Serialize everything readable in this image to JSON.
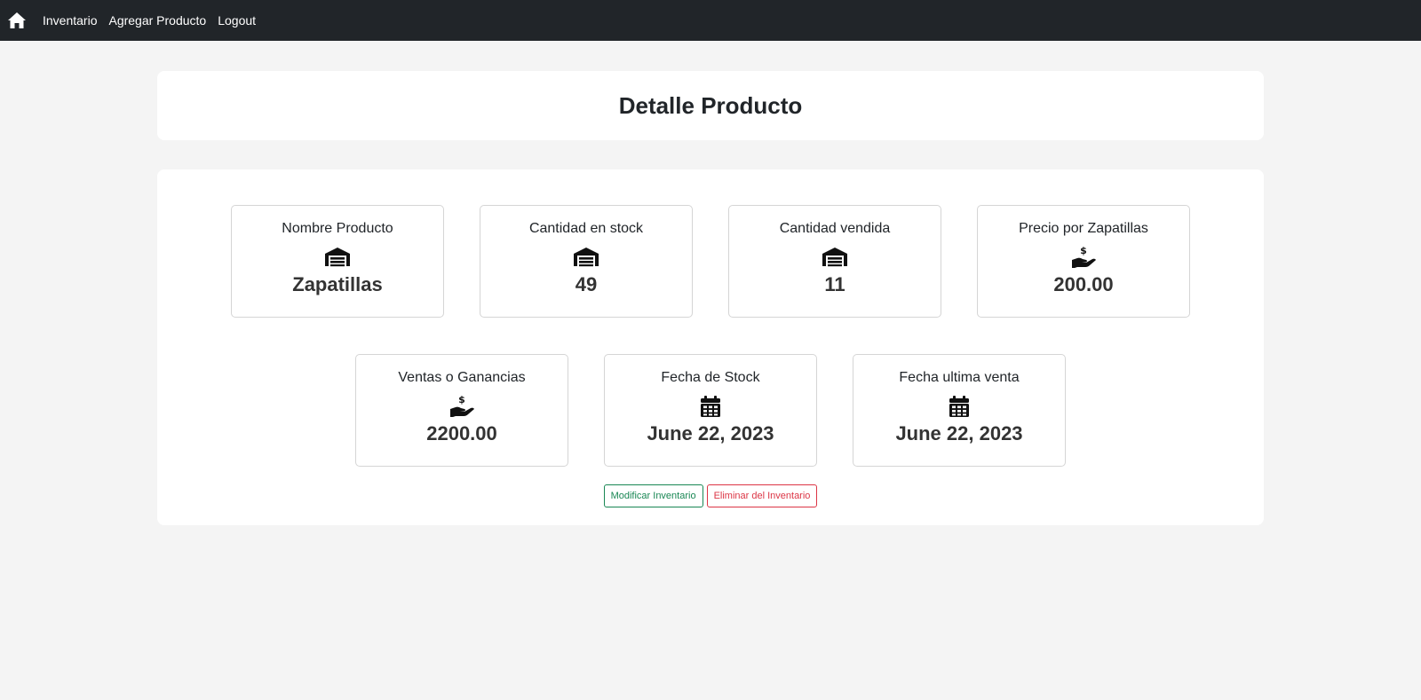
{
  "nav": {
    "home_icon": "home-icon",
    "links": [
      "Inventario",
      "Agregar Producto",
      "Logout"
    ]
  },
  "page": {
    "title": "Detalle Producto"
  },
  "cards": [
    {
      "label": "Nombre Producto",
      "icon": "warehouse-icon",
      "value": "Zapatillas"
    },
    {
      "label": "Cantidad en stock",
      "icon": "warehouse-icon",
      "value": "49"
    },
    {
      "label": "Cantidad vendida",
      "icon": "warehouse-icon",
      "value": "11"
    },
    {
      "label": "Precio por Zapatillas",
      "icon": "hand-holding-dollar-icon",
      "value": "200.00"
    },
    {
      "label": "Ventas o Ganancias",
      "icon": "hand-holding-dollar-icon",
      "value": "2200.00"
    },
    {
      "label": "Fecha de Stock",
      "icon": "calendar-icon",
      "value": "June 22, 2023"
    },
    {
      "label": "Fecha ultima venta",
      "icon": "calendar-icon",
      "value": "June 22, 2023"
    }
  ],
  "actions": {
    "modify_label": "Modificar Inventario",
    "delete_label": "Eliminar del Inventario"
  },
  "colors": {
    "navbar": "#212529",
    "success": "#198754",
    "danger": "#dc3545"
  }
}
